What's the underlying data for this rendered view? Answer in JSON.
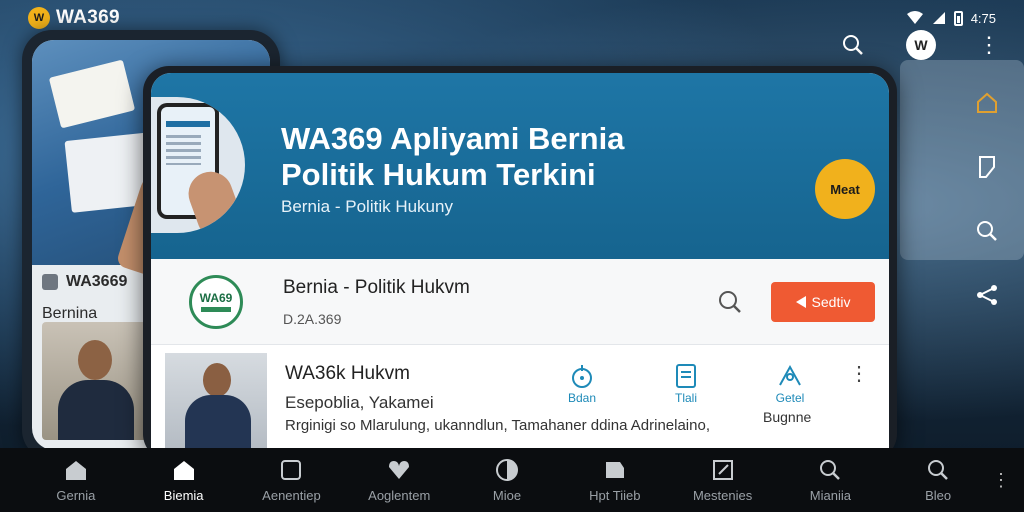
{
  "status_bar": {
    "brand_logo": "W",
    "brand_name": "WA369",
    "clock": "4:75"
  },
  "top_tools": [
    "search-icon",
    "avatar-icon",
    "more-vertical-icon"
  ],
  "avatar_text": "W",
  "side_rail": [
    "home-icon",
    "bookmark-icon",
    "search-icon",
    "share-icon"
  ],
  "left_phone": {
    "brand": "WA3669",
    "label": "Bernina"
  },
  "hero": {
    "title_line1": "WA369 Apliyami Bernia",
    "title_line2": "Politik Hukum Terkini",
    "subtitle": "Bernia - Politik Hukuny",
    "badge": "Meat"
  },
  "channel": {
    "logo_text": "WA69",
    "title": "Bernia - Politik Hukvm",
    "meta": "D.2A.369",
    "subscribe_label": "Sedtiv"
  },
  "video": {
    "title": "WA36k Hukvm",
    "subtitle": "Esepoblia, Yakamei",
    "description": "Rrginigi so Mlarulung, ukanndlun, Tamahaner ddina Adrinelaino,",
    "extra_label": "Bugnne",
    "actions": [
      {
        "icon": "location-icon",
        "label": "Bdan"
      },
      {
        "icon": "document-icon",
        "label": "Tlali"
      },
      {
        "icon": "share-icon",
        "label": "Getel"
      }
    ]
  },
  "bottom_nav": {
    "items": [
      {
        "icon": "home-icon",
        "label": "Gernia",
        "active": false
      },
      {
        "icon": "home-icon",
        "label": "Biemia",
        "active": true
      },
      {
        "icon": "crop-icon",
        "label": "Aenentiep",
        "active": false
      },
      {
        "icon": "heart-icon",
        "label": "Aoglentem",
        "active": false
      },
      {
        "icon": "circle-icon",
        "label": "Mioe",
        "active": false
      },
      {
        "icon": "tag-icon",
        "label": "Hpt Tiieb",
        "active": false
      },
      {
        "icon": "edit-icon",
        "label": "Mestenies",
        "active": false
      },
      {
        "icon": "search-icon",
        "label": "Mianiia",
        "active": false
      },
      {
        "icon": "search-icon",
        "label": "Bleo",
        "active": false
      }
    ]
  },
  "colors": {
    "accent": "#1e76a6",
    "subscribe": "#ef5a33",
    "badge": "#f1b11c",
    "action_text": "#1e8ab8"
  }
}
